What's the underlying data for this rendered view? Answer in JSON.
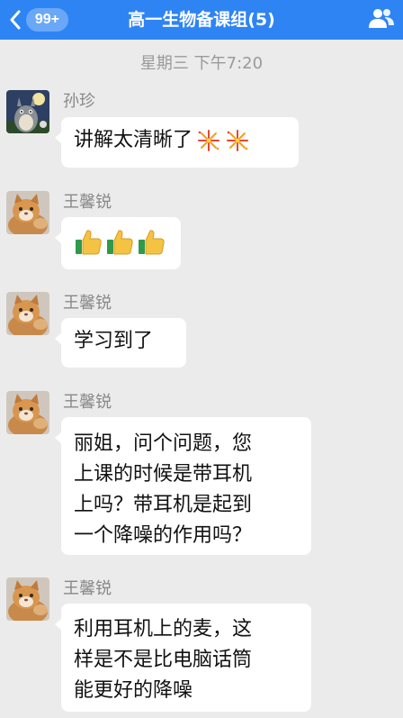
{
  "header": {
    "unread_badge": "99+",
    "title": "高一生物备课组(5)"
  },
  "timestamp": "星期三 下午7:20",
  "messages": [
    {
      "sender": "孙珍",
      "text": "讲解太清晰了",
      "emojis": [
        "fireworks-icon",
        "fireworks-icon"
      ]
    },
    {
      "sender": "王馨锐",
      "text": "",
      "emojis": [
        "thumbs-up-icon",
        "thumbs-up-icon",
        "thumbs-up-icon"
      ]
    },
    {
      "sender": "王馨锐",
      "text": "学习到了"
    },
    {
      "sender": "王馨锐",
      "lines": [
        "丽姐，问个问题，您",
        "上课的时候是带耳机",
        "上吗？带耳机是起到",
        "一个降噪的作用吗？"
      ]
    },
    {
      "sender": "王馨锐",
      "lines": [
        "利用耳机上的麦，这",
        "样是不是比电脑话筒",
        "能更好的降噪"
      ]
    }
  ],
  "colors": {
    "header_bg": "#2f84f3",
    "badge_bg": "#6aa8f7",
    "chat_bg": "#ebebeb",
    "bubble_bg": "#ffffff",
    "meta_text": "#888888"
  }
}
